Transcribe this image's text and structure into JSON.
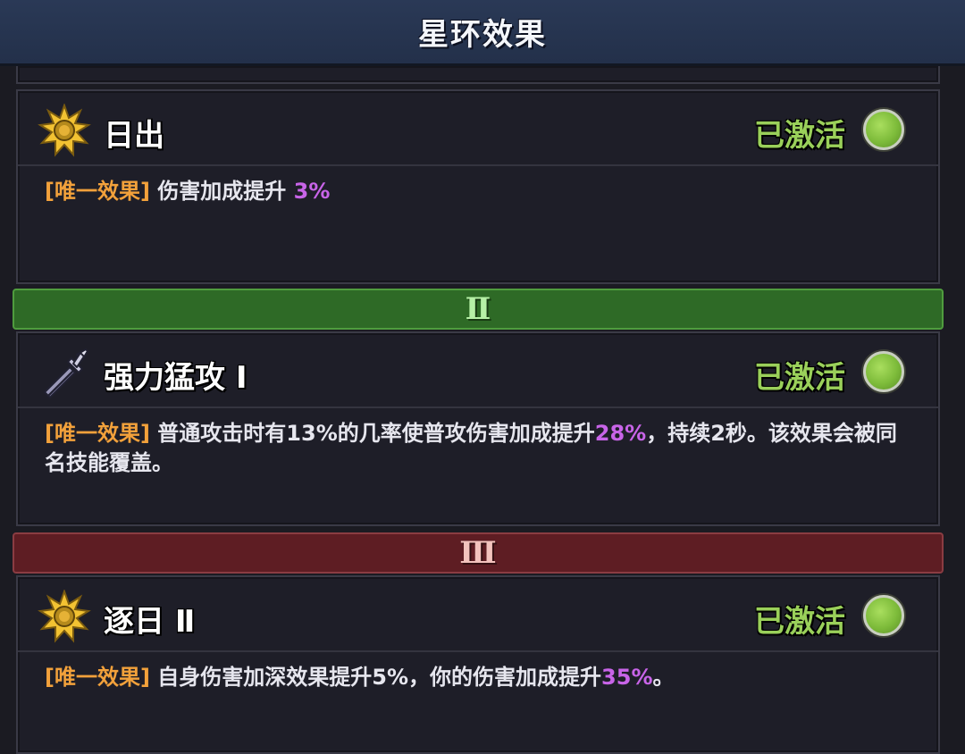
{
  "header": {
    "title": "星环效果"
  },
  "effects": [
    {
      "icon": "sun-burst-icon",
      "name": "日出",
      "status": "已激活",
      "tag": "[唯一效果]",
      "desc_parts": [
        " 伤害加成提升 ",
        "3%",
        ""
      ]
    },
    {
      "icon": "sword-icon",
      "name": "强力猛攻 Ⅰ",
      "status": "已激活",
      "tag": "[唯一效果]",
      "desc_parts": [
        " 普通攻击时有13%的几率使普攻伤害加成提升",
        "28%",
        "，持续2秒。该效果会被同名技能覆盖。"
      ]
    },
    {
      "icon": "sun-burst-icon",
      "name": "逐日 Ⅱ",
      "status": "已激活",
      "tag": "[唯一效果]",
      "desc_parts": [
        " 自身伤害加深效果提升5%，你的伤害加成提升",
        "35%",
        "。"
      ]
    }
  ],
  "tiers": [
    "Ⅱ",
    "Ⅲ"
  ],
  "colors": {
    "active_green": "#9ad05a",
    "tag_orange": "#f2a13b",
    "highlight_purple": "#c864e8",
    "tier2_green": "#2e6a26",
    "tier3_red": "#5e1d23"
  }
}
